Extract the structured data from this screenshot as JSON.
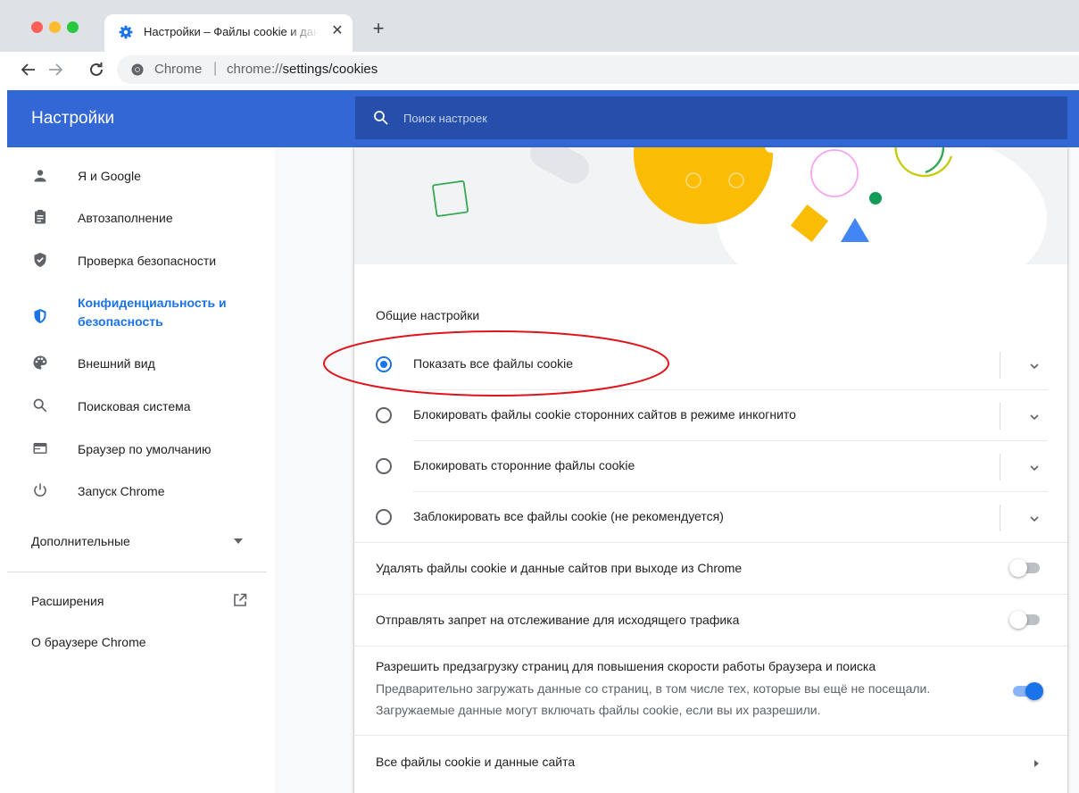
{
  "browser": {
    "tab_title": "Настройки – Файлы cookie и данные сайтов",
    "tab_close": "✕",
    "new_tab": "+",
    "omnibox_host": "Chrome",
    "omnibox_url_prefix": "chrome://",
    "omnibox_url_path": "settings/cookies"
  },
  "header": {
    "title": "Настройки",
    "search_placeholder": "Поиск настроек"
  },
  "sidebar": {
    "items": [
      {
        "label": "Я и Google",
        "icon": "person-icon"
      },
      {
        "label": "Автозаполнение",
        "icon": "clipboard-icon"
      },
      {
        "label": "Проверка безопасности",
        "icon": "shield-check-icon"
      },
      {
        "label": "Конфиденциальность и безопасность",
        "label_line1": "Конфиденциальность и",
        "label_line2": "безопасность",
        "icon": "shield-half-icon",
        "active": true
      },
      {
        "label": "Внешний вид",
        "icon": "palette-icon"
      },
      {
        "label": "Поисковая система",
        "icon": "search-icon"
      },
      {
        "label": "Браузер по умолчанию",
        "icon": "browser-window-icon"
      },
      {
        "label": "Запуск Chrome",
        "icon": "power-icon"
      }
    ],
    "advanced_label": "Дополнительные",
    "extensions_label": "Расширения",
    "about_label": "О браузере Chrome"
  },
  "cookies": {
    "section_title": "Общие настройки",
    "options": [
      {
        "label": "Показать все файлы cookie",
        "checked": true
      },
      {
        "label": "Блокировать файлы cookie сторонних сайтов в режиме инкогнито",
        "checked": false
      },
      {
        "label": "Блокировать сторонние файлы cookie",
        "checked": false
      },
      {
        "label": "Заблокировать все файлы cookie (не рекомендуется)",
        "checked": false
      }
    ],
    "toggles": [
      {
        "label": "Удалять файлы cookie и данные сайтов при выходе из Chrome",
        "on": false
      },
      {
        "label": "Отправлять запрет на отслеживание для исходящего трафика",
        "on": false
      },
      {
        "label": "Разрешить предзагрузку страниц для повышения скорости работы браузера и поиска",
        "sub_line1": "Предварительно загружать данные со страниц, в том числе тех, которые вы ещё не посещали.",
        "sub_line2": "Загружаемые данные могут включать файлы cookie, если вы их разрешили.",
        "on": true
      }
    ],
    "all_cookies_link": "Все файлы cookie и данные сайта"
  },
  "colors": {
    "header_blue": "#3367d6",
    "search_blue": "#254fab",
    "accent": "#1a73e8",
    "annotation_red": "#e0141b"
  }
}
